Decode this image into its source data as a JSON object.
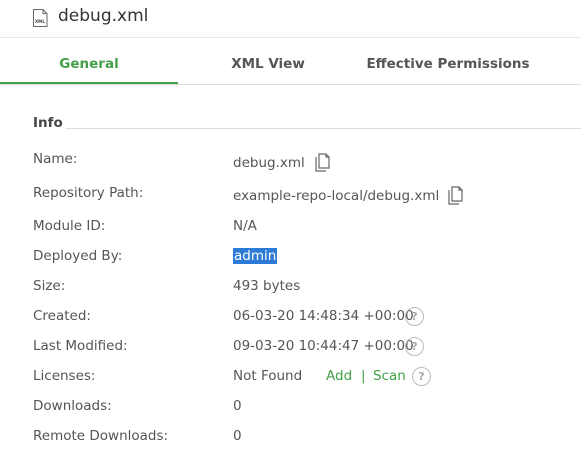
{
  "header": {
    "title": "debug.xml",
    "file_icon_text": "XML"
  },
  "tabs": [
    {
      "label": "General",
      "active": true
    },
    {
      "label": "XML View",
      "active": false
    },
    {
      "label": "Effective Permissions",
      "active": false
    }
  ],
  "info": {
    "section_title": "Info",
    "name": {
      "label": "Name:",
      "value": "debug.xml"
    },
    "repository_path": {
      "label": "Repository Path:",
      "value": "example-repo-local/debug.xml"
    },
    "module_id": {
      "label": "Module ID:",
      "value": "N/A"
    },
    "deployed_by": {
      "label": "Deployed By:",
      "value": "admin"
    },
    "size": {
      "label": "Size:",
      "value": "493 bytes"
    },
    "created": {
      "label": "Created:",
      "value": "06-03-20 14:48:34 +00:00"
    },
    "last_modified": {
      "label": "Last Modified:",
      "value": "09-03-20 10:44:47 +00:00"
    },
    "licenses": {
      "label": "Licenses:",
      "value": "Not Found",
      "add_label": "Add",
      "separator": "|",
      "scan_label": "Scan"
    },
    "downloads": {
      "label": "Downloads:",
      "value": "0"
    },
    "remote_downloads": {
      "label": "Remote Downloads:",
      "value": "0"
    }
  },
  "help_icon_glyph": "?",
  "colors": {
    "accent": "#43a047",
    "selection": "#2d7bd6"
  }
}
